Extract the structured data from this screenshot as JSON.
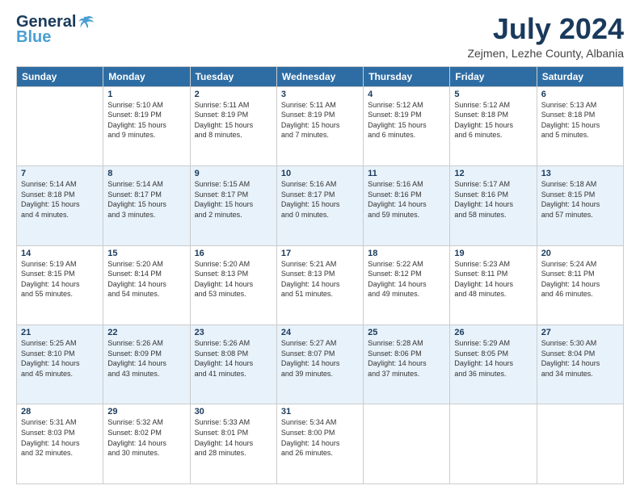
{
  "logo": {
    "line1": "General",
    "line2": "Blue",
    "accent": "Blue"
  },
  "header": {
    "month": "July 2024",
    "location": "Zejmen, Lezhe County, Albania"
  },
  "weekdays": [
    "Sunday",
    "Monday",
    "Tuesday",
    "Wednesday",
    "Thursday",
    "Friday",
    "Saturday"
  ],
  "weeks": [
    [
      {
        "day": "",
        "info": ""
      },
      {
        "day": "1",
        "info": "Sunrise: 5:10 AM\nSunset: 8:19 PM\nDaylight: 15 hours\nand 9 minutes."
      },
      {
        "day": "2",
        "info": "Sunrise: 5:11 AM\nSunset: 8:19 PM\nDaylight: 15 hours\nand 8 minutes."
      },
      {
        "day": "3",
        "info": "Sunrise: 5:11 AM\nSunset: 8:19 PM\nDaylight: 15 hours\nand 7 minutes."
      },
      {
        "day": "4",
        "info": "Sunrise: 5:12 AM\nSunset: 8:19 PM\nDaylight: 15 hours\nand 6 minutes."
      },
      {
        "day": "5",
        "info": "Sunrise: 5:12 AM\nSunset: 8:18 PM\nDaylight: 15 hours\nand 6 minutes."
      },
      {
        "day": "6",
        "info": "Sunrise: 5:13 AM\nSunset: 8:18 PM\nDaylight: 15 hours\nand 5 minutes."
      }
    ],
    [
      {
        "day": "7",
        "info": "Sunrise: 5:14 AM\nSunset: 8:18 PM\nDaylight: 15 hours\nand 4 minutes."
      },
      {
        "day": "8",
        "info": "Sunrise: 5:14 AM\nSunset: 8:17 PM\nDaylight: 15 hours\nand 3 minutes."
      },
      {
        "day": "9",
        "info": "Sunrise: 5:15 AM\nSunset: 8:17 PM\nDaylight: 15 hours\nand 2 minutes."
      },
      {
        "day": "10",
        "info": "Sunrise: 5:16 AM\nSunset: 8:17 PM\nDaylight: 15 hours\nand 0 minutes."
      },
      {
        "day": "11",
        "info": "Sunrise: 5:16 AM\nSunset: 8:16 PM\nDaylight: 14 hours\nand 59 minutes."
      },
      {
        "day": "12",
        "info": "Sunrise: 5:17 AM\nSunset: 8:16 PM\nDaylight: 14 hours\nand 58 minutes."
      },
      {
        "day": "13",
        "info": "Sunrise: 5:18 AM\nSunset: 8:15 PM\nDaylight: 14 hours\nand 57 minutes."
      }
    ],
    [
      {
        "day": "14",
        "info": "Sunrise: 5:19 AM\nSunset: 8:15 PM\nDaylight: 14 hours\nand 55 minutes."
      },
      {
        "day": "15",
        "info": "Sunrise: 5:20 AM\nSunset: 8:14 PM\nDaylight: 14 hours\nand 54 minutes."
      },
      {
        "day": "16",
        "info": "Sunrise: 5:20 AM\nSunset: 8:13 PM\nDaylight: 14 hours\nand 53 minutes."
      },
      {
        "day": "17",
        "info": "Sunrise: 5:21 AM\nSunset: 8:13 PM\nDaylight: 14 hours\nand 51 minutes."
      },
      {
        "day": "18",
        "info": "Sunrise: 5:22 AM\nSunset: 8:12 PM\nDaylight: 14 hours\nand 49 minutes."
      },
      {
        "day": "19",
        "info": "Sunrise: 5:23 AM\nSunset: 8:11 PM\nDaylight: 14 hours\nand 48 minutes."
      },
      {
        "day": "20",
        "info": "Sunrise: 5:24 AM\nSunset: 8:11 PM\nDaylight: 14 hours\nand 46 minutes."
      }
    ],
    [
      {
        "day": "21",
        "info": "Sunrise: 5:25 AM\nSunset: 8:10 PM\nDaylight: 14 hours\nand 45 minutes."
      },
      {
        "day": "22",
        "info": "Sunrise: 5:26 AM\nSunset: 8:09 PM\nDaylight: 14 hours\nand 43 minutes."
      },
      {
        "day": "23",
        "info": "Sunrise: 5:26 AM\nSunset: 8:08 PM\nDaylight: 14 hours\nand 41 minutes."
      },
      {
        "day": "24",
        "info": "Sunrise: 5:27 AM\nSunset: 8:07 PM\nDaylight: 14 hours\nand 39 minutes."
      },
      {
        "day": "25",
        "info": "Sunrise: 5:28 AM\nSunset: 8:06 PM\nDaylight: 14 hours\nand 37 minutes."
      },
      {
        "day": "26",
        "info": "Sunrise: 5:29 AM\nSunset: 8:05 PM\nDaylight: 14 hours\nand 36 minutes."
      },
      {
        "day": "27",
        "info": "Sunrise: 5:30 AM\nSunset: 8:04 PM\nDaylight: 14 hours\nand 34 minutes."
      }
    ],
    [
      {
        "day": "28",
        "info": "Sunrise: 5:31 AM\nSunset: 8:03 PM\nDaylight: 14 hours\nand 32 minutes."
      },
      {
        "day": "29",
        "info": "Sunrise: 5:32 AM\nSunset: 8:02 PM\nDaylight: 14 hours\nand 30 minutes."
      },
      {
        "day": "30",
        "info": "Sunrise: 5:33 AM\nSunset: 8:01 PM\nDaylight: 14 hours\nand 28 minutes."
      },
      {
        "day": "31",
        "info": "Sunrise: 5:34 AM\nSunset: 8:00 PM\nDaylight: 14 hours\nand 26 minutes."
      },
      {
        "day": "",
        "info": ""
      },
      {
        "day": "",
        "info": ""
      },
      {
        "day": "",
        "info": ""
      }
    ]
  ]
}
